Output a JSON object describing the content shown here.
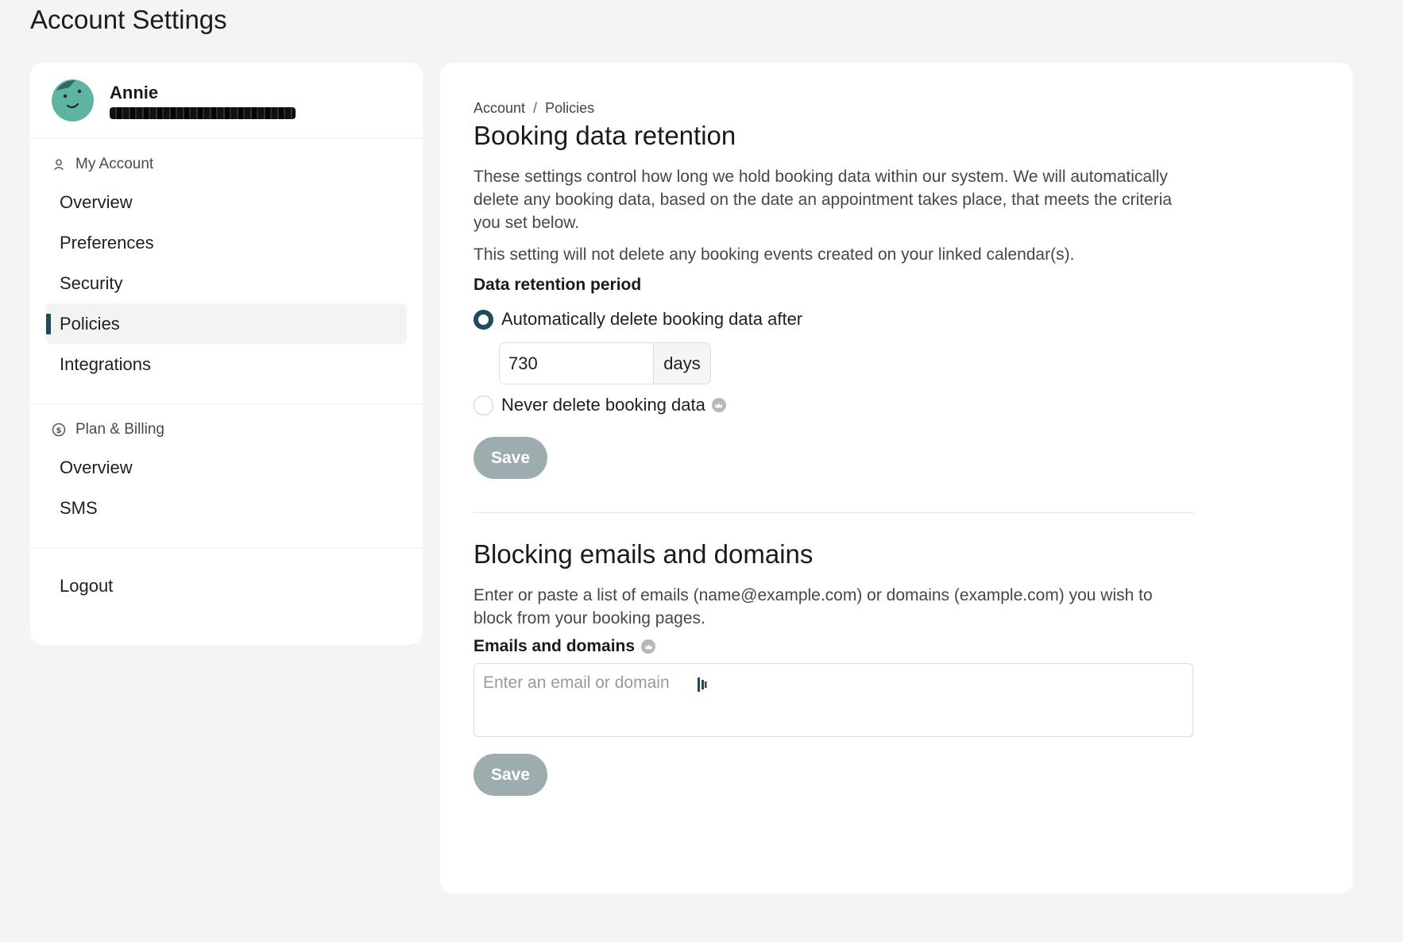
{
  "page": {
    "title": "Account Settings"
  },
  "profile": {
    "name": "Annie"
  },
  "sidebar": {
    "my_account": {
      "header": "My Account",
      "items": [
        {
          "label": "Overview"
        },
        {
          "label": "Preferences"
        },
        {
          "label": "Security"
        },
        {
          "label": "Policies",
          "active": true
        },
        {
          "label": "Integrations"
        }
      ]
    },
    "billing": {
      "header": "Plan & Billing",
      "items": [
        {
          "label": "Overview"
        },
        {
          "label": "SMS"
        }
      ]
    },
    "logout_label": "Logout"
  },
  "breadcrumb": {
    "parent": "Account",
    "separator": "/",
    "current": "Policies"
  },
  "retention": {
    "title": "Booking data retention",
    "description": "These settings control how long we hold booking data within our system. We will automatically delete any booking data, based on the date an appointment takes place, that meets the criteria you set below.",
    "note": "This setting will not delete any booking events created on your linked calendar(s).",
    "period_label": "Data retention period",
    "option_auto": "Automatically delete booking data after",
    "days_value": "730",
    "days_suffix": "days",
    "option_never": "Never delete booking data",
    "save_label": "Save"
  },
  "blocking": {
    "title": "Blocking emails and domains",
    "description": "Enter or paste a list of emails (name@example.com) or domains (example.com) you wish to block from your booking pages.",
    "field_label": "Emails and domains",
    "placeholder": "Enter an email or domain",
    "save_label": "Save"
  },
  "colors": {
    "accent": "#1e4d59",
    "avatar": "#5fb3a1",
    "save_disabled": "#9cacaf",
    "background": "#f4f4f4"
  }
}
